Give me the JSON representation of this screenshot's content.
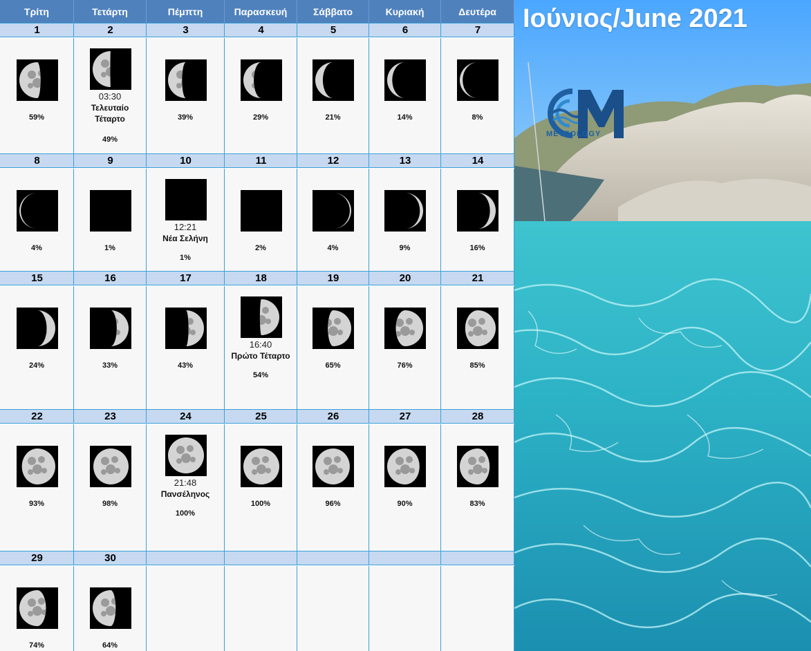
{
  "title": "Ιούνιος/June 2021",
  "logo_text": "METEOLOGY",
  "weekdays": [
    "Τρίτη",
    "Τετάρτη",
    "Πέμπτη",
    "Παρασκευή",
    "Σάββατο",
    "Κυριακή",
    "Δευτέρα"
  ],
  "days": [
    {
      "day": "1",
      "illum": "59%",
      "phase": 0.59,
      "waxing": false
    },
    {
      "day": "2",
      "illum": "49%",
      "phase": 0.49,
      "waxing": false,
      "time": "03:30",
      "event": "Τελευταίο Τέταρτο"
    },
    {
      "day": "3",
      "illum": "39%",
      "phase": 0.39,
      "waxing": false
    },
    {
      "day": "4",
      "illum": "29%",
      "phase": 0.29,
      "waxing": false
    },
    {
      "day": "5",
      "illum": "21%",
      "phase": 0.21,
      "waxing": false
    },
    {
      "day": "6",
      "illum": "14%",
      "phase": 0.14,
      "waxing": false
    },
    {
      "day": "7",
      "illum": "8%",
      "phase": 0.08,
      "waxing": false
    },
    {
      "day": "8",
      "illum": "4%",
      "phase": 0.04,
      "waxing": false
    },
    {
      "day": "9",
      "illum": "1%",
      "phase": 0.01,
      "waxing": false
    },
    {
      "day": "10",
      "illum": "1%",
      "phase": 0.0,
      "waxing": true,
      "time": "12:21",
      "event": "Νέα Σελήνη"
    },
    {
      "day": "11",
      "illum": "2%",
      "phase": 0.01,
      "waxing": true
    },
    {
      "day": "12",
      "illum": "4%",
      "phase": 0.04,
      "waxing": true
    },
    {
      "day": "13",
      "illum": "9%",
      "phase": 0.09,
      "waxing": true
    },
    {
      "day": "14",
      "illum": "16%",
      "phase": 0.16,
      "waxing": true
    },
    {
      "day": "15",
      "illum": "24%",
      "phase": 0.24,
      "waxing": true
    },
    {
      "day": "16",
      "illum": "33%",
      "phase": 0.33,
      "waxing": true
    },
    {
      "day": "17",
      "illum": "43%",
      "phase": 0.43,
      "waxing": true
    },
    {
      "day": "18",
      "illum": "54%",
      "phase": 0.54,
      "waxing": true,
      "time": "16:40",
      "event": "Πρώτο Τέταρτο"
    },
    {
      "day": "19",
      "illum": "65%",
      "phase": 0.65,
      "waxing": true
    },
    {
      "day": "20",
      "illum": "76%",
      "phase": 0.76,
      "waxing": true
    },
    {
      "day": "21",
      "illum": "85%",
      "phase": 0.85,
      "waxing": true
    },
    {
      "day": "22",
      "illum": "93%",
      "phase": 0.93,
      "waxing": true
    },
    {
      "day": "23",
      "illum": "98%",
      "phase": 0.98,
      "waxing": true
    },
    {
      "day": "24",
      "illum": "100%",
      "phase": 1.0,
      "waxing": true,
      "time": "21:48",
      "event": "Πανσέληνος"
    },
    {
      "day": "25",
      "illum": "100%",
      "phase": 1.0,
      "waxing": false
    },
    {
      "day": "26",
      "illum": "96%",
      "phase": 0.96,
      "waxing": false
    },
    {
      "day": "27",
      "illum": "90%",
      "phase": 0.9,
      "waxing": false
    },
    {
      "day": "28",
      "illum": "83%",
      "phase": 0.83,
      "waxing": false
    },
    {
      "day": "29",
      "illum": "74%",
      "phase": 0.74,
      "waxing": false
    },
    {
      "day": "30",
      "illum": "64%",
      "phase": 0.64,
      "waxing": false
    }
  ],
  "colors": {
    "header": "#4f81bd",
    "number_row": "#c6d9f1",
    "grid_line": "#3aa0d8",
    "cell": "#f7f7f7",
    "sea": "#2fb4c8"
  }
}
